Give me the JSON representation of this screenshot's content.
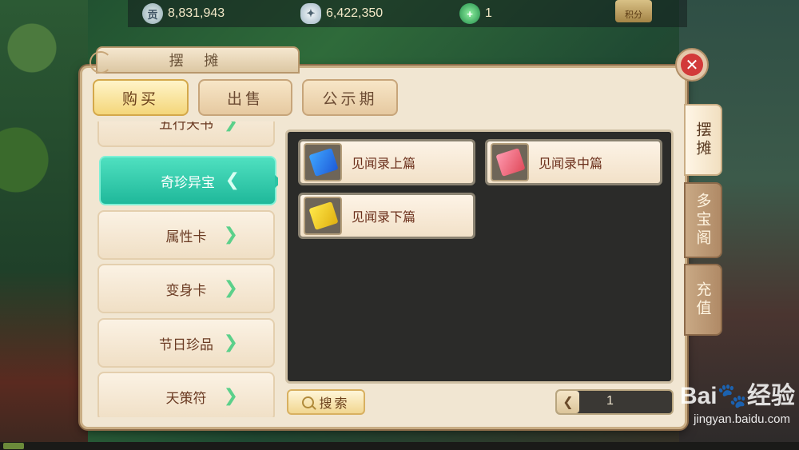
{
  "resources": {
    "gong": {
      "icon": "gong-currency-icon",
      "glyph": "贡",
      "value": "8,831,943"
    },
    "silver": {
      "icon": "silver-ingot-icon",
      "value": "6,422,350"
    },
    "jade": {
      "icon": "jade-coin-icon",
      "value": "1"
    },
    "score_label": "积分"
  },
  "window": {
    "title": "摆 摊",
    "close_glyph": "✕"
  },
  "tabs": [
    {
      "label": "购买",
      "active": true
    },
    {
      "label": "出售",
      "active": false
    },
    {
      "label": "公示期",
      "active": false
    }
  ],
  "categories": [
    {
      "label": "五行天书"
    },
    {
      "label": "奇珍异宝",
      "active": true
    },
    {
      "label": "属性卡"
    },
    {
      "label": "变身卡"
    },
    {
      "label": "节日珍品"
    },
    {
      "label": "天策符"
    }
  ],
  "arrows": {
    "normal": "❯",
    "active": "❮"
  },
  "items": [
    {
      "name": "见闻录上篇",
      "color": "#3fa6ff"
    },
    {
      "name": "见闻录中篇",
      "color": "#e04a5a"
    },
    {
      "name": "见闻录下篇",
      "color": "#ffe84a"
    }
  ],
  "search": {
    "label": "搜索"
  },
  "pager": {
    "prev": "❮",
    "page": "1"
  },
  "side_tabs": [
    {
      "label": "摆摊",
      "active": true
    },
    {
      "label": "多宝阁",
      "active": false
    },
    {
      "label": "充值",
      "active": false
    }
  ],
  "watermark": {
    "logo": "Bai🐾经验",
    "url": "jingyan.baidu.com"
  }
}
